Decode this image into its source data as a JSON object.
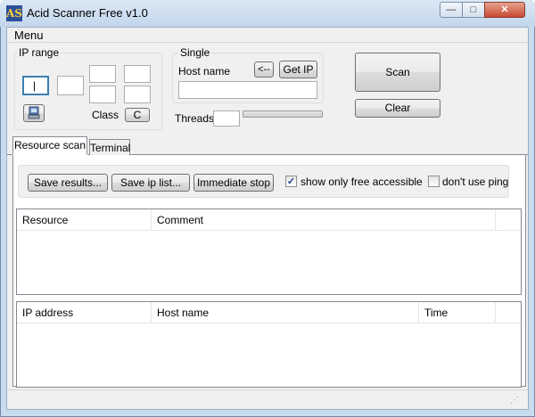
{
  "window": {
    "title": "Acid Scanner Free v1.0",
    "app_icon_text": "AS"
  },
  "caption_buttons": {
    "minimize": "—",
    "maximize": "□",
    "close": "✕"
  },
  "menu": {
    "label": "Menu"
  },
  "ip_range": {
    "label": "IP range",
    "class_label": "Class",
    "class_button": "C",
    "active_field_value": "|"
  },
  "single": {
    "label": "Single",
    "host_name_label": "Host name",
    "arrow_button": "<--",
    "get_ip_button": "Get IP",
    "host_name_value": ""
  },
  "threads": {
    "label": "Threads",
    "value": ""
  },
  "actions": {
    "scan": "Scan",
    "clear": "Clear"
  },
  "tabs": [
    {
      "label": "Resource scan",
      "active": true
    },
    {
      "label": "Terminal",
      "active": false
    }
  ],
  "toolbar": {
    "save_results": "Save results...",
    "save_ip_list": "Save ip list...",
    "immediate_stop": "Immediate stop",
    "show_only_free": {
      "label": "show only free accessible",
      "checked": true
    },
    "dont_use_ping": {
      "label": "don't use ping",
      "checked": false
    }
  },
  "resource_table": {
    "columns": [
      "Resource",
      "Comment"
    ],
    "rows": []
  },
  "ip_table": {
    "columns": [
      "IP address",
      "Host name",
      "Time"
    ],
    "rows": []
  },
  "colors": {
    "title_bar": "#c9dcee",
    "close_button": "#c84a33",
    "checkbox_mark": "#1c3f8a"
  }
}
